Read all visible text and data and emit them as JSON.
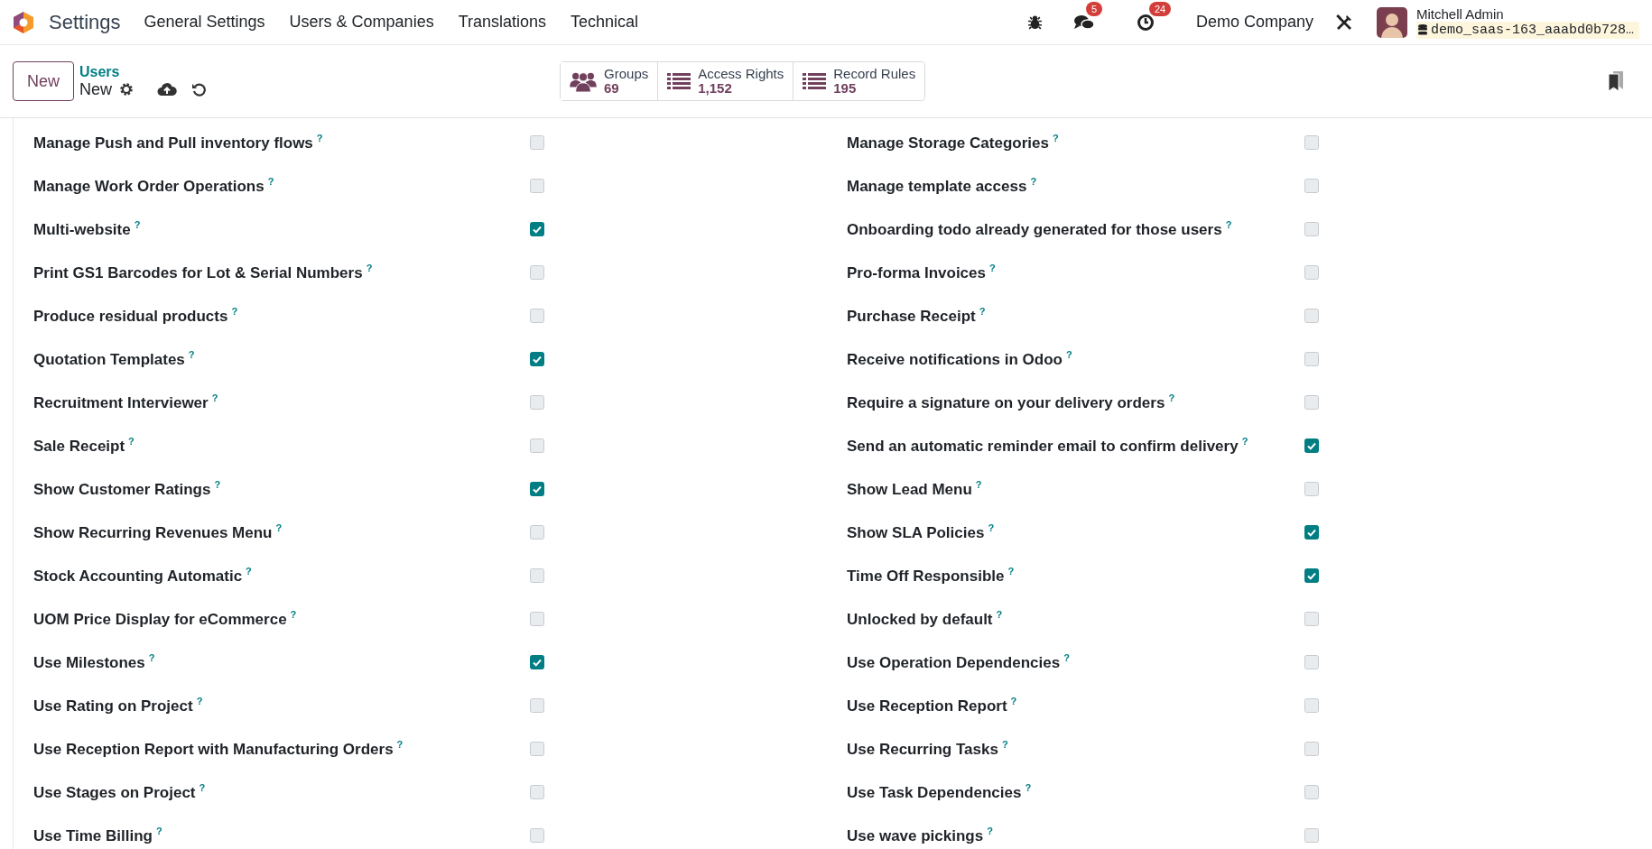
{
  "navbar": {
    "app_name": "Settings",
    "menus": [
      "General Settings",
      "Users & Companies",
      "Translations",
      "Technical"
    ],
    "messages_count": "5",
    "activities_count": "24",
    "company": "Demo Company",
    "user_name": "Mitchell Admin",
    "database": "demo_saas-163_aaabd0b728…"
  },
  "control_panel": {
    "new_button": "New",
    "breadcrumb_parent": "Users",
    "breadcrumb_current": "New",
    "stat_buttons": [
      {
        "kind": "groups",
        "label": "Groups",
        "value": "69"
      },
      {
        "kind": "list",
        "label": "Access Rights",
        "value": "1,152"
      },
      {
        "kind": "list",
        "label": "Record Rules",
        "value": "195"
      }
    ]
  },
  "left_column": [
    {
      "label": "Manage Push and Pull inventory flows",
      "help": "?",
      "checked": false
    },
    {
      "label": "Manage Work Order Operations",
      "help": "?",
      "checked": false
    },
    {
      "label": "Multi-website",
      "help": "?",
      "checked": true
    },
    {
      "label": "Print GS1 Barcodes for Lot & Serial Numbers",
      "help": "?",
      "checked": false
    },
    {
      "label": "Produce residual products",
      "help": "?",
      "checked": false
    },
    {
      "label": "Quotation Templates",
      "help": "?",
      "checked": true
    },
    {
      "label": "Recruitment Interviewer",
      "help": "?",
      "checked": false
    },
    {
      "label": "Sale Receipt",
      "help": "?",
      "checked": false
    },
    {
      "label": "Show Customer Ratings",
      "help": "?",
      "checked": true
    },
    {
      "label": "Show Recurring Revenues Menu",
      "help": "?",
      "checked": false
    },
    {
      "label": "Stock Accounting Automatic",
      "help": "?",
      "checked": false
    },
    {
      "label": "UOM Price Display for eCommerce",
      "help": "?",
      "checked": false
    },
    {
      "label": "Use Milestones",
      "help": "?",
      "checked": true
    },
    {
      "label": "Use Rating on Project",
      "help": "?",
      "checked": false
    },
    {
      "label": "Use Reception Report with Manufacturing Orders",
      "help": "?",
      "checked": false
    },
    {
      "label": "Use Stages on Project",
      "help": "?",
      "checked": false
    },
    {
      "label": "Use Time Billing",
      "help": "?",
      "checked": false
    }
  ],
  "right_column": [
    {
      "label": "Manage Storage Categories",
      "help": "?",
      "checked": false
    },
    {
      "label": "Manage template access",
      "help": "?",
      "checked": false
    },
    {
      "label": "Onboarding todo already generated for those users",
      "help": "?",
      "checked": false
    },
    {
      "label": "Pro-forma Invoices",
      "help": "?",
      "checked": false
    },
    {
      "label": "Purchase Receipt",
      "help": "?",
      "checked": false
    },
    {
      "label": "Receive notifications in Odoo",
      "help": "?",
      "checked": false
    },
    {
      "label": "Require a signature on your delivery orders",
      "help": "?",
      "checked": false
    },
    {
      "label": "Send an automatic reminder email to confirm delivery",
      "help": "?",
      "checked": true
    },
    {
      "label": "Show Lead Menu",
      "help": "?",
      "checked": false
    },
    {
      "label": "Show SLA Policies",
      "help": "?",
      "checked": true
    },
    {
      "label": "Time Off Responsible",
      "help": "?",
      "checked": true
    },
    {
      "label": "Unlocked by default",
      "help": "?",
      "checked": false
    },
    {
      "label": "Use Operation Dependencies",
      "help": "?",
      "checked": false
    },
    {
      "label": "Use Reception Report",
      "help": "?",
      "checked": false
    },
    {
      "label": "Use Recurring Tasks",
      "help": "?",
      "checked": false
    },
    {
      "label": "Use Task Dependencies",
      "help": "?",
      "checked": false
    },
    {
      "label": "Use wave pickings",
      "help": "?",
      "checked": false
    }
  ]
}
